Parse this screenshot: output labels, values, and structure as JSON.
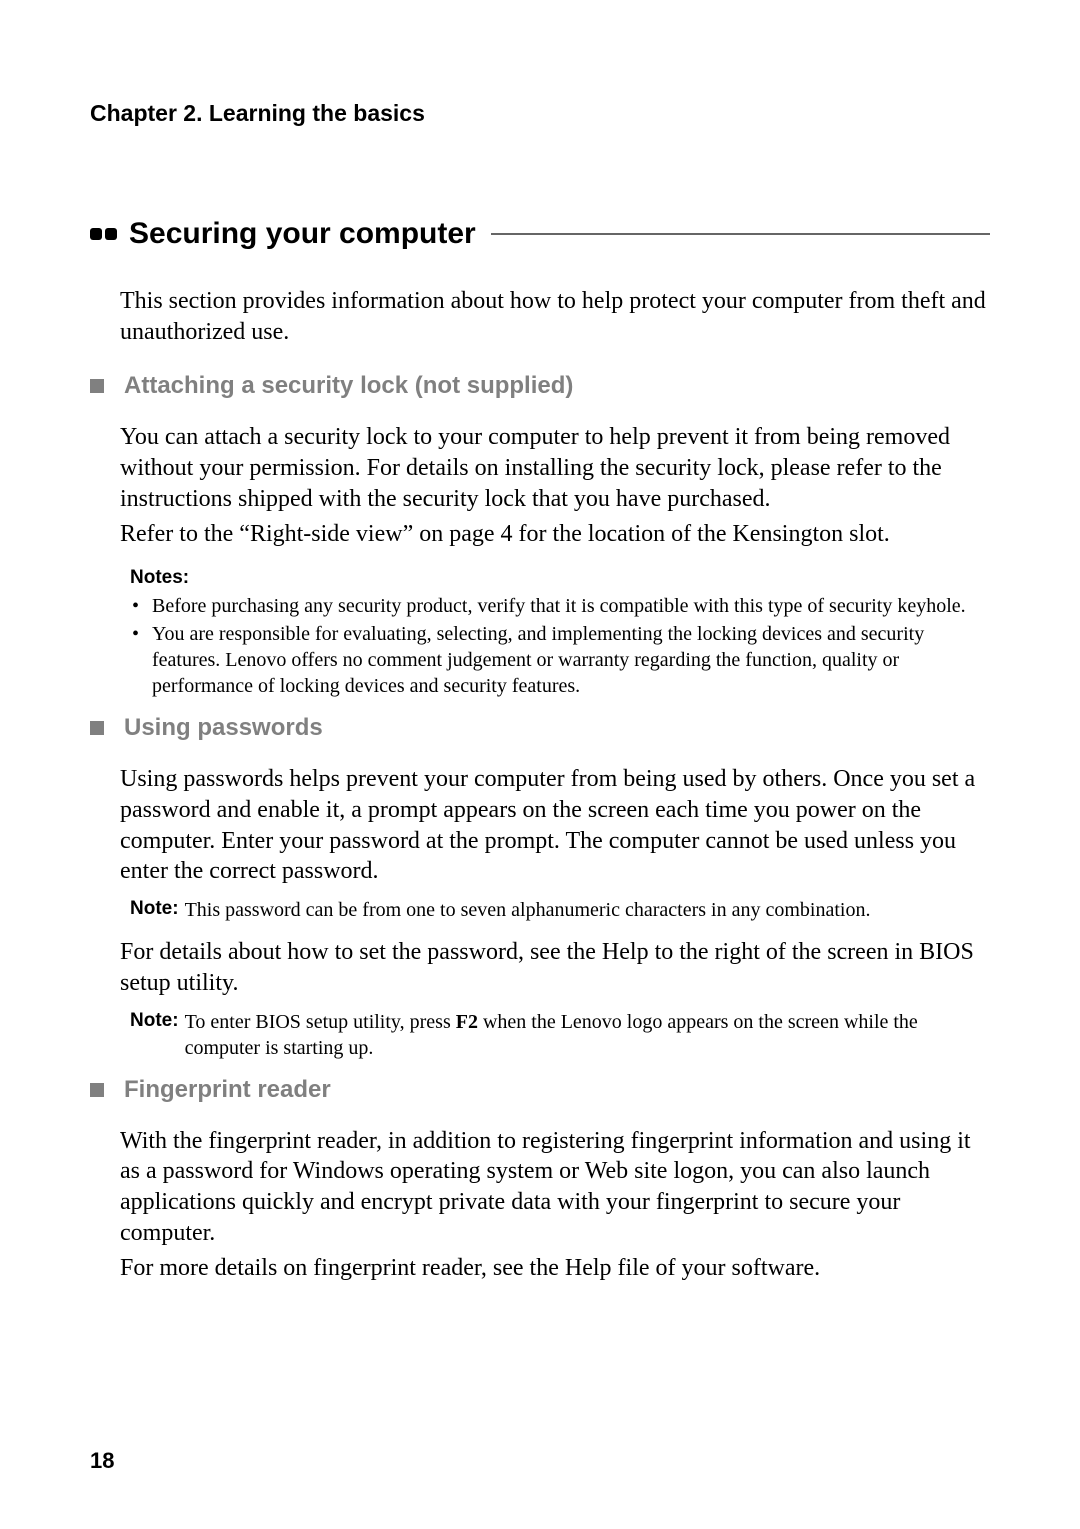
{
  "chapter": "Chapter 2. Learning the basics",
  "main_heading": "Securing your computer",
  "intro": "This section provides information about how to help protect your computer from theft and unauthorized use.",
  "sections": {
    "s1": {
      "heading": "Attaching a security lock (not supplied)",
      "p1": "You can attach a security lock to your computer to help prevent it from being removed without your permission. For details on installing the security lock, please refer to the instructions shipped with the security lock that you have purchased.",
      "p2": "Refer to the “Right-side view” on page 4 for the location of the Kensington slot.",
      "notes_label": "Notes:",
      "note1": "Before purchasing any security product, verify that it is compatible with this type of security keyhole.",
      "note2": "You are responsible for evaluating, selecting, and implementing the locking devices and security features. Lenovo offers no comment judgement or warranty regarding the function, quality or performance of locking devices and security features."
    },
    "s2": {
      "heading": "Using passwords",
      "p1": "Using passwords helps prevent your computer from being used by others. Once you set a password and enable it, a prompt appears on the screen each time you power on the computer. Enter your password at the prompt. The computer cannot be used unless you enter the correct password.",
      "note1_label": "Note:",
      "note1": "This password can be from one to seven alphanumeric characters in any combination.",
      "p2": "For details about how to set the password, see the Help to the right of the screen in BIOS setup utility.",
      "note2_label": "Note:",
      "note2a": "To enter BIOS setup utility, press ",
      "note2_key": "F2",
      "note2b": " when the Lenovo logo appears on the screen while the computer is starting up."
    },
    "s3": {
      "heading": "Fingerprint reader",
      "p1": "With the fingerprint reader, in addition to registering fingerprint information and using it as a password for Windows operating system or Web site logon, you can also launch applications quickly and encrypt private data with your fingerprint to secure your computer.",
      "p2": "For more details on fingerprint reader, see the Help file of your software."
    }
  },
  "page_number": "18"
}
